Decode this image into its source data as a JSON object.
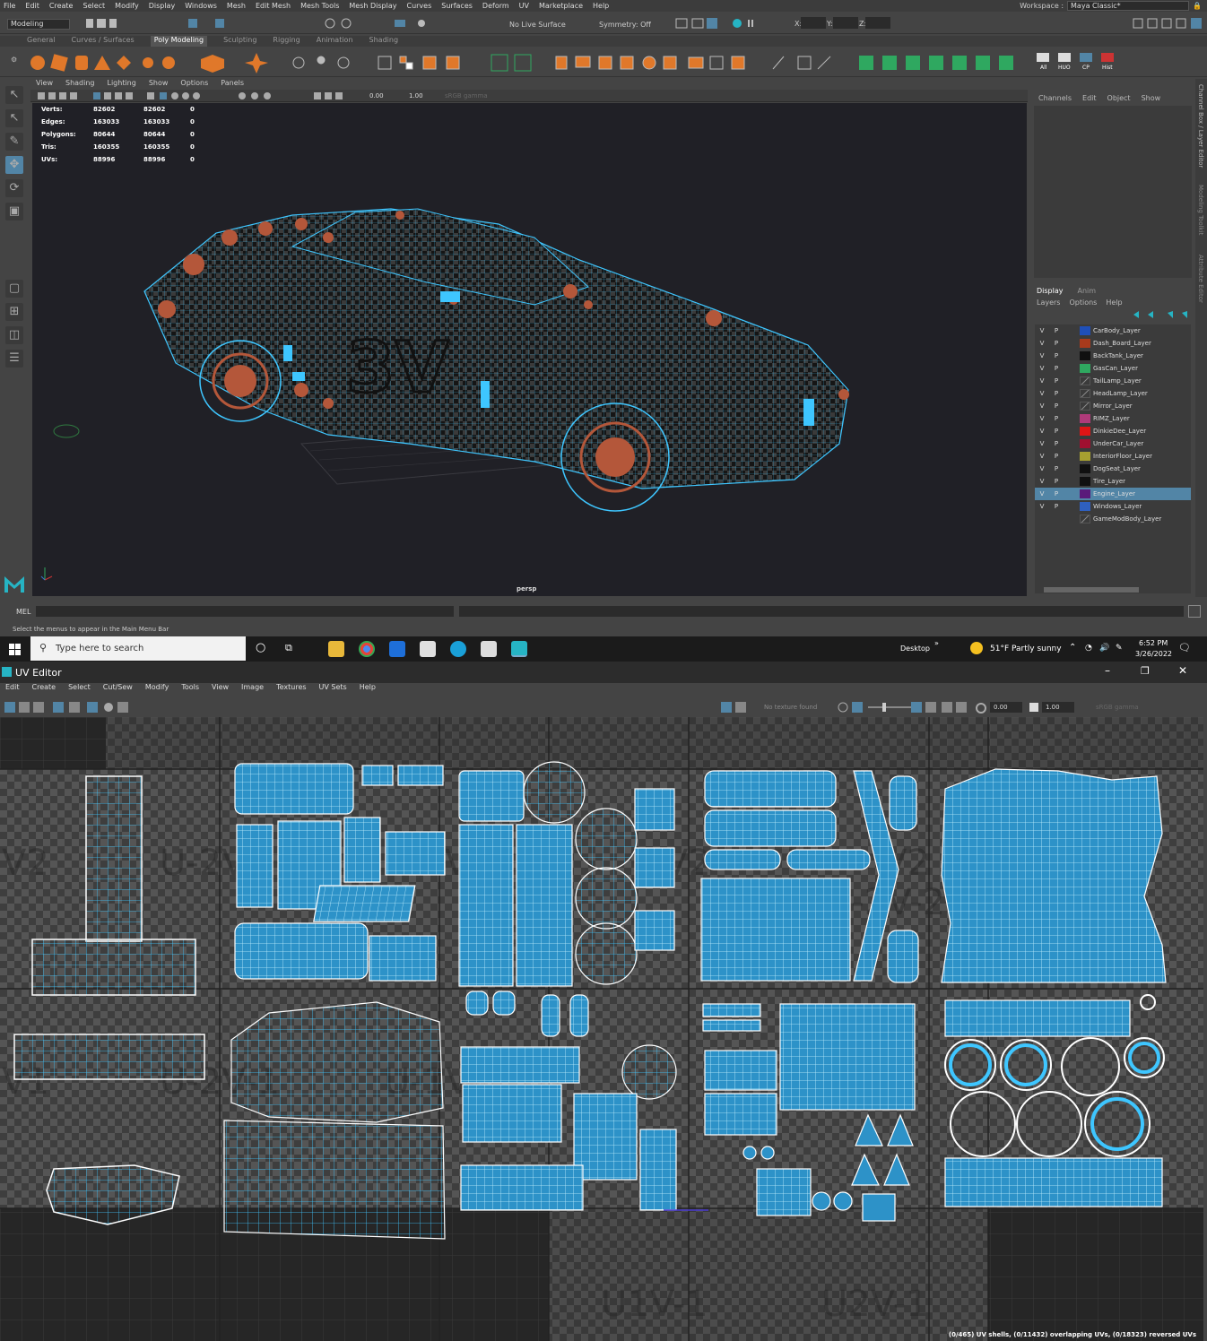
{
  "maya": {
    "menu": [
      "File",
      "Edit",
      "Create",
      "Select",
      "Modify",
      "Display",
      "Windows",
      "Mesh",
      "Edit Mesh",
      "Mesh Tools",
      "Mesh Display",
      "Curves",
      "Surfaces",
      "Deform",
      "UV",
      "Marketplace",
      "Help"
    ],
    "workspace_label": "Workspace :",
    "workspace_value": "Maya Classic*",
    "mode": "Modeling",
    "no_live_surface": "No Live Surface",
    "symmetry": "Symmetry: Off",
    "xyz": [
      "X:",
      "Y:",
      "Z:"
    ],
    "shelf_tabs": [
      "General",
      "Curves / Surfaces",
      "Poly Modeling",
      "Sculpting",
      "Rigging",
      "Animation",
      "Shading"
    ],
    "shelf_active": "Poly Modeling",
    "shelf_labels": [
      "All",
      "HUO",
      "CP",
      "Hist"
    ],
    "panel_menu": [
      "View",
      "Shading",
      "Lighting",
      "Show",
      "Options",
      "Panels"
    ],
    "panel_values": [
      "0.00",
      "1.00",
      "sRGB gamma"
    ],
    "hud": [
      {
        "label": "Verts:",
        "a": "82602",
        "b": "82602",
        "c": "0"
      },
      {
        "label": "Edges:",
        "a": "163033",
        "b": "163033",
        "c": "0"
      },
      {
        "label": "Polygons:",
        "a": "80644",
        "b": "80644",
        "c": "0"
      },
      {
        "label": "Tris:",
        "a": "160355",
        "b": "160355",
        "c": "0"
      },
      {
        "label": "UVs:",
        "a": "88996",
        "b": "88996",
        "c": "0"
      }
    ],
    "camera": "persp",
    "channel_menu": [
      "Channels",
      "Edit",
      "Object",
      "Show"
    ],
    "layer_tabs": [
      "Display",
      "Anim"
    ],
    "layer_menu": [
      "Layers",
      "Options",
      "Help"
    ],
    "layers": [
      {
        "v": "V",
        "p": "P",
        "color": "#1f4fb8",
        "name": "CarBody_Layer"
      },
      {
        "v": "V",
        "p": "P",
        "color": "#a83a1c",
        "name": "Dash_Board_Layer"
      },
      {
        "v": "V",
        "p": "P",
        "color": "#101010",
        "name": "BackTank_Layer"
      },
      {
        "v": "V",
        "p": "P",
        "color": "#2fa860",
        "name": "GasCan_Layer"
      },
      {
        "v": "V",
        "p": "P",
        "color": "none",
        "name": "TailLamp_Layer"
      },
      {
        "v": "V",
        "p": "P",
        "color": "none",
        "name": "HeadLamp_Layer"
      },
      {
        "v": "V",
        "p": "P",
        "color": "none",
        "name": "Mirror_Layer"
      },
      {
        "v": "V",
        "p": "P",
        "color": "#b03a7a",
        "name": "RIMZ_Layer"
      },
      {
        "v": "V",
        "p": "P",
        "color": "#e01515",
        "name": "DinkieDee_Layer"
      },
      {
        "v": "V",
        "p": "P",
        "color": "#a01030",
        "name": "UnderCar_Layer"
      },
      {
        "v": "V",
        "p": "P",
        "color": "#a6a030",
        "name": "InteriorFloor_Layer"
      },
      {
        "v": "V",
        "p": "P",
        "color": "#101010",
        "name": "DogSeat_Layer"
      },
      {
        "v": "V",
        "p": "P",
        "color": "#101010",
        "name": "Tire_Layer"
      },
      {
        "v": "V",
        "p": "P",
        "color": "#5a1a7a",
        "name": "Engine_Layer"
      },
      {
        "v": "V",
        "p": "P",
        "color": "#2f60c0",
        "name": "Windows_Layer"
      },
      {
        "v": "",
        "p": "",
        "color": "none",
        "name": "GameModBody_Layer"
      }
    ],
    "selected_layer": "Engine_Layer",
    "side_tabs": [
      "Channel Box / Layer Editor",
      "Modeling Toolkit",
      "Attribute Editor"
    ],
    "mel": "MEL",
    "help_line": "Select the menus to appear in the Main Menu Bar"
  },
  "taskbar": {
    "search_placeholder": "Type here to search",
    "desktop": "Desktop",
    "weather": "51°F  Partly sunny",
    "time": "6:52 PM",
    "date": "3/26/2022"
  },
  "uv_editor": {
    "title": "UV Editor",
    "menu": [
      "Edit",
      "Create",
      "Select",
      "Cut/Sew",
      "Modify",
      "Tools",
      "View",
      "Image",
      "Textures",
      "UV Sets",
      "Help"
    ],
    "no_texture": "No texture found",
    "values": [
      "0.00",
      "1.00",
      "sRGB gamma"
    ],
    "tile_labels": [
      "V2",
      "U-2V",
      "V2",
      "V2",
      "V2",
      "U-2V-2",
      "V1",
      "U-2V-1",
      "U-1V-1",
      "U1V-1",
      "U2V-1"
    ],
    "footer": "(0/465) UV shells, (0/11432) overlapping UVs, (0/18323) reversed UVs"
  },
  "colors": {
    "accent": "#5285a6",
    "wire": "#3ec6ff",
    "vertex": "#b4573a",
    "maya_logo": "#26b4c4"
  }
}
